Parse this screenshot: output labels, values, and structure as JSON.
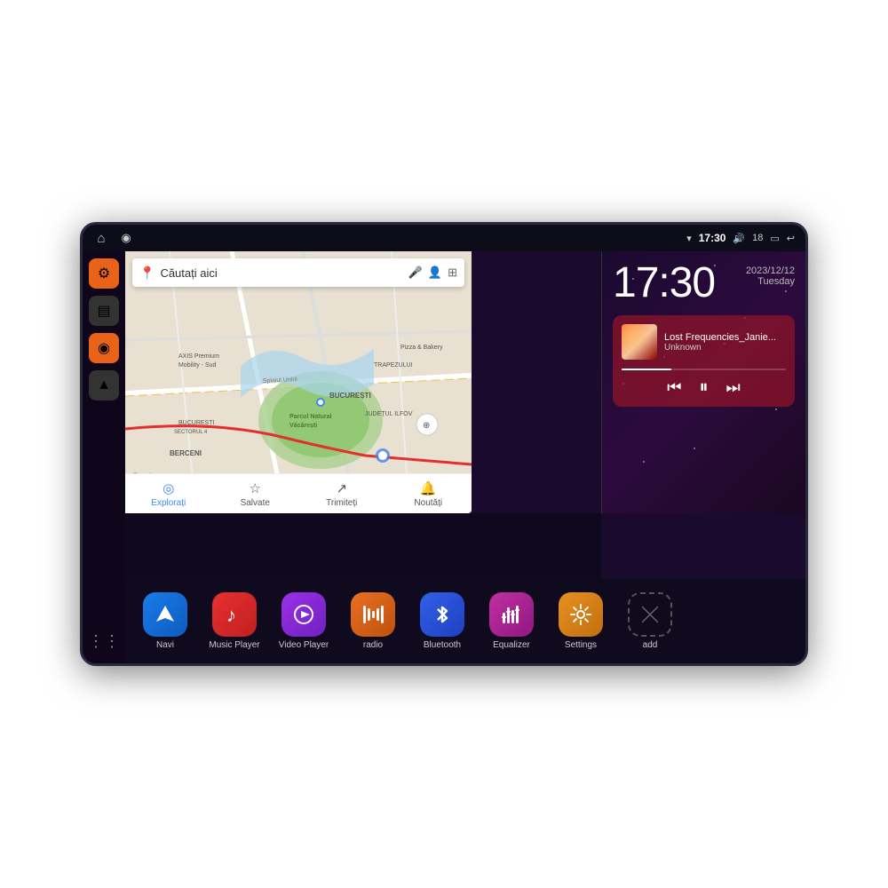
{
  "statusBar": {
    "time": "17:30",
    "battery": "18",
    "icons": {
      "home": "⌂",
      "map": "◎",
      "wifi": "▾",
      "volume": "🔊",
      "battery_icon": "🔋",
      "back": "↩"
    }
  },
  "sidebar": {
    "buttons": [
      {
        "id": "settings",
        "icon": "⚙",
        "color": "orange"
      },
      {
        "id": "folder",
        "icon": "▤",
        "color": "dark"
      },
      {
        "id": "map",
        "icon": "◉",
        "color": "orange"
      },
      {
        "id": "nav",
        "icon": "▲",
        "color": "dark"
      }
    ],
    "gridIcon": "⋮⋮⋮"
  },
  "map": {
    "searchPlaceholder": "Căutați aici",
    "bottomNav": [
      {
        "id": "explore",
        "icon": "◎",
        "label": "Explorați",
        "active": true
      },
      {
        "id": "saved",
        "icon": "☆",
        "label": "Salvate",
        "active": false
      },
      {
        "id": "share",
        "icon": "↗",
        "label": "Trimiteți",
        "active": false
      },
      {
        "id": "news",
        "icon": "🔔",
        "label": "Noutăți",
        "active": false
      }
    ],
    "places": [
      "AXIS Premium Mobility - Sud",
      "Pizza & Bakery",
      "Parcul Natural Văcărești",
      "BUCUREȘTI",
      "BUCUREȘTI SECTORUL 4",
      "JUDEȚUL ILFOV",
      "BERCENI",
      "TRAPEZULUI"
    ]
  },
  "clock": {
    "time": "17:30",
    "date": "2023/12/12",
    "day": "Tuesday"
  },
  "music": {
    "title": "Lost Frequencies_Janie...",
    "artist": "Unknown",
    "controls": {
      "prev": "⏮",
      "play": "⏸",
      "next": "⏭"
    }
  },
  "apps": [
    {
      "id": "navi",
      "icon": "▲",
      "label": "Navi",
      "iconClass": "icon-navi"
    },
    {
      "id": "music",
      "icon": "♫",
      "label": "Music Player",
      "iconClass": "icon-music"
    },
    {
      "id": "video",
      "icon": "▶",
      "label": "Video Player",
      "iconClass": "icon-video"
    },
    {
      "id": "radio",
      "icon": "📶",
      "label": "radio",
      "iconClass": "icon-radio"
    },
    {
      "id": "bluetooth",
      "icon": "ᛒ",
      "label": "Bluetooth",
      "iconClass": "icon-bt"
    },
    {
      "id": "equalizer",
      "icon": "≡",
      "label": "Equalizer",
      "iconClass": "icon-eq"
    },
    {
      "id": "settings",
      "icon": "⚙",
      "label": "Settings",
      "iconClass": "icon-settings"
    },
    {
      "id": "add",
      "icon": "+",
      "label": "add",
      "iconClass": "icon-add"
    }
  ]
}
